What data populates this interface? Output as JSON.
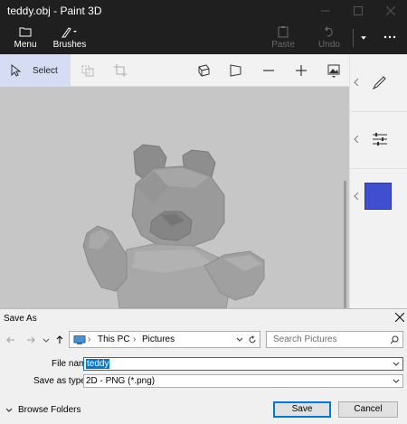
{
  "window": {
    "title": "teddy.obj - Paint 3D"
  },
  "ribbon": {
    "menu_label": "Menu",
    "brushes_label": "Brushes",
    "paste_label": "Paste",
    "undo_label": "Undo"
  },
  "toolbar": {
    "select_label": "Select"
  },
  "side_panel": {
    "color_swatch": "#3f4fd0"
  },
  "dialog": {
    "title": "Save As",
    "path": [
      "This PC",
      "Pictures"
    ],
    "search_placeholder": "Search Pictures",
    "file_name_label": "File name:",
    "file_name_value": "teddy",
    "save_as_type_label": "Save as type:",
    "save_as_type_value": "2D - PNG (*.png)",
    "browse_folders_label": "Browse Folders",
    "save_button": "Save",
    "cancel_button": "Cancel"
  },
  "colors": {
    "accent": "#0078d7",
    "titlebar": "#1f1f1f",
    "canvas": "#c6c6c6"
  }
}
